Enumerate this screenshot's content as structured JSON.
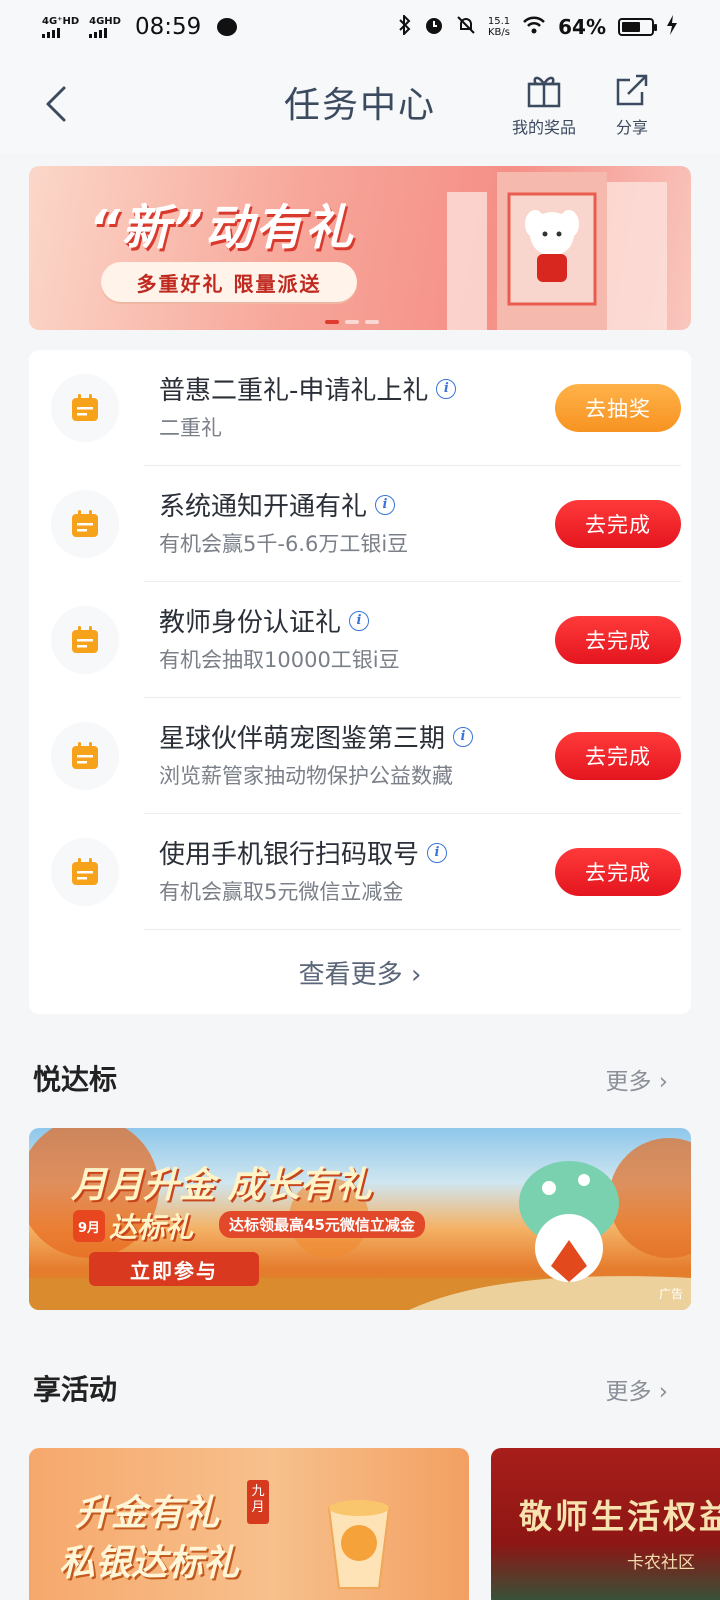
{
  "status_bar": {
    "net1": "4G⁺HD",
    "net2": "4GHD",
    "time": "08:59",
    "speed_value": "15.1",
    "speed_unit": "KB/s",
    "battery": "64%"
  },
  "header": {
    "title": "任务中心",
    "prize_label": "我的奖品",
    "share_label": "分享"
  },
  "banner": {
    "title": "“新”动有礼",
    "pill": "多重好礼 限量派送"
  },
  "tasks": [
    {
      "title": "普惠二重礼-申请礼上礼",
      "subtitle": "二重礼",
      "button": "去抽奖",
      "button_style": "orange"
    },
    {
      "title": "系统通知开通有礼",
      "subtitle": "有机会赢5千-6.6万工银i豆",
      "button": "去完成",
      "button_style": "red"
    },
    {
      "title": "教师身份认证礼",
      "subtitle": "有机会抽取10000工银i豆",
      "button": "去完成",
      "button_style": "red"
    },
    {
      "title": "星球伙伴萌宠图鉴第三期",
      "subtitle": "浏览薪管家抽动物保护公益数藏",
      "button": "去完成",
      "button_style": "red"
    },
    {
      "title": "使用手机银行扫码取号",
      "subtitle": "有机会赢取5元微信立减金",
      "button": "去完成",
      "button_style": "red"
    }
  ],
  "more_tasks": "查看更多",
  "section1": {
    "heading": "悦达标",
    "more": "更多"
  },
  "ad_banner": {
    "line1": "月月升金 成长有礼",
    "badge": "9月",
    "line2": "达标礼",
    "promo": "达标领最高45元微信立减金",
    "cta": "立即参与",
    "tag": "广告"
  },
  "section2": {
    "heading": "享活动",
    "more": "更多"
  },
  "activity_cards": [
    {
      "line1": "升金有礼",
      "line2": "私银达标礼",
      "month": "九月"
    },
    {
      "title": "敬师生活权益",
      "sub": "卡农社区"
    }
  ],
  "colors": {
    "primary_red": "#e4151f",
    "orange": "#f79321",
    "icon_orange": "#f7a21b",
    "header_text": "#3b4a5e"
  }
}
